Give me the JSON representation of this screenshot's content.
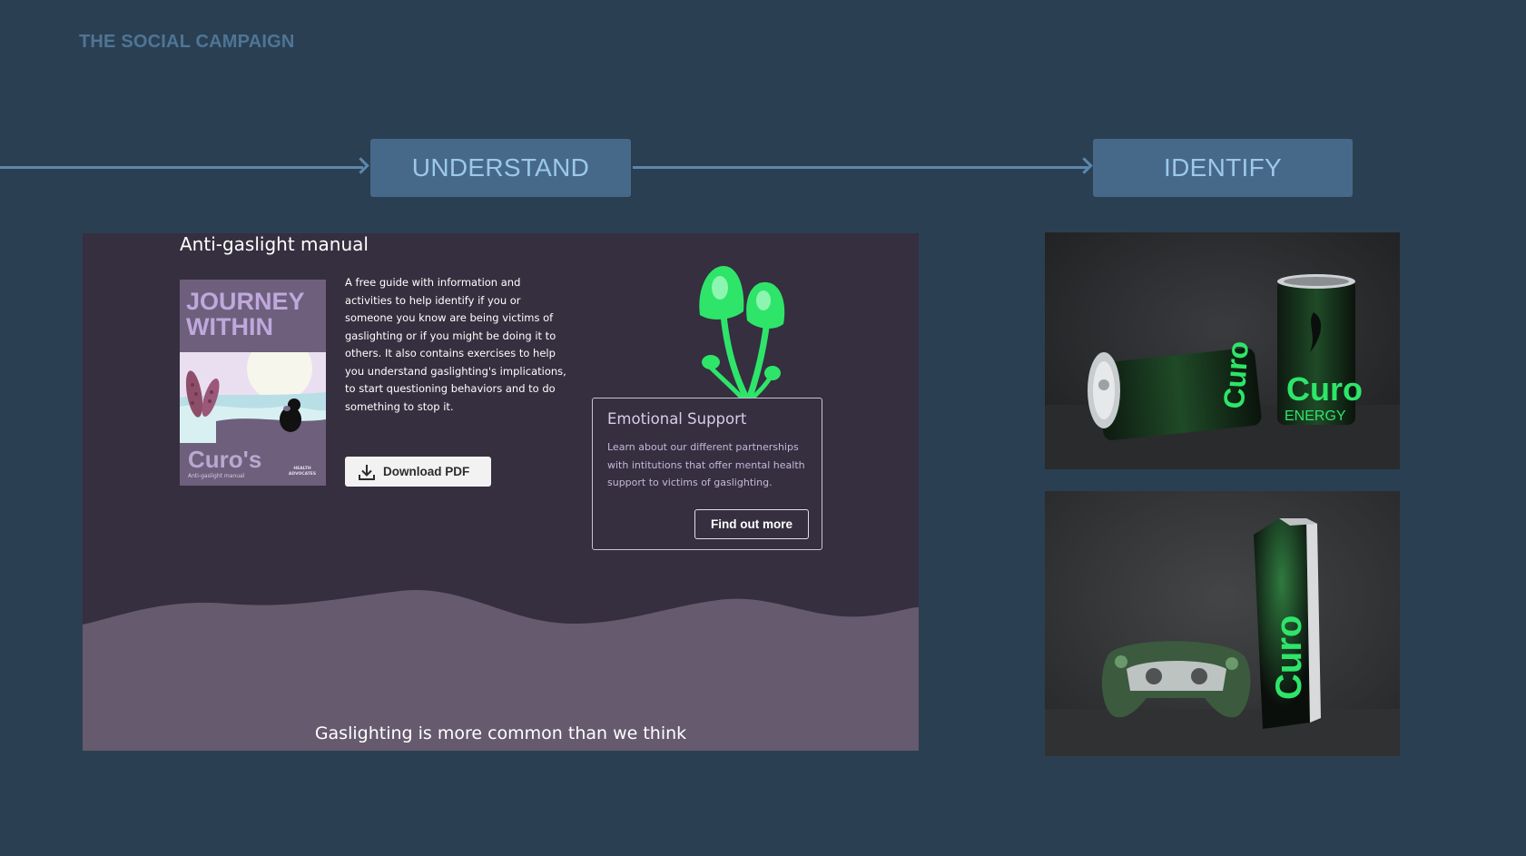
{
  "header": {
    "title": "THE SOCIAL CAMPAIGN"
  },
  "flow": {
    "steps": [
      {
        "label": "UNDERSTAND"
      },
      {
        "label": "IDENTIFY"
      }
    ]
  },
  "manual_card": {
    "title": "Anti-gaslight manual",
    "cover": {
      "title": "JOURNEY WITHIN",
      "brand": "Curo's",
      "subtitle": "Anti-gaslight manual",
      "badge": "HEALTH ADVOCATES"
    },
    "description": "A free guide with information and activities to help identify if you or someone you know are being victims of gaslighting or if you might be doing it to others. It also contains exercises to help you understand gaslighting's implications, to start questioning behaviors and to do something to stop it.",
    "download_label": "Download PDF",
    "support": {
      "title": "Emotional Support",
      "text": "Learn about our different partnerships with intitutions that offer mental health support to victims of gaslighting.",
      "button_label": "Find out more"
    },
    "footer": "Gaslighting is more common than we think"
  },
  "products": {
    "can_brand": "Curo",
    "can_sub": "ENERGY",
    "console_brand": "Curo"
  },
  "colors": {
    "background": "#2b3f52",
    "accent_blue": "#46698a",
    "card_dark": "#352f3f",
    "card_wave": "#665a6e",
    "brand_green": "#2ee56a"
  }
}
